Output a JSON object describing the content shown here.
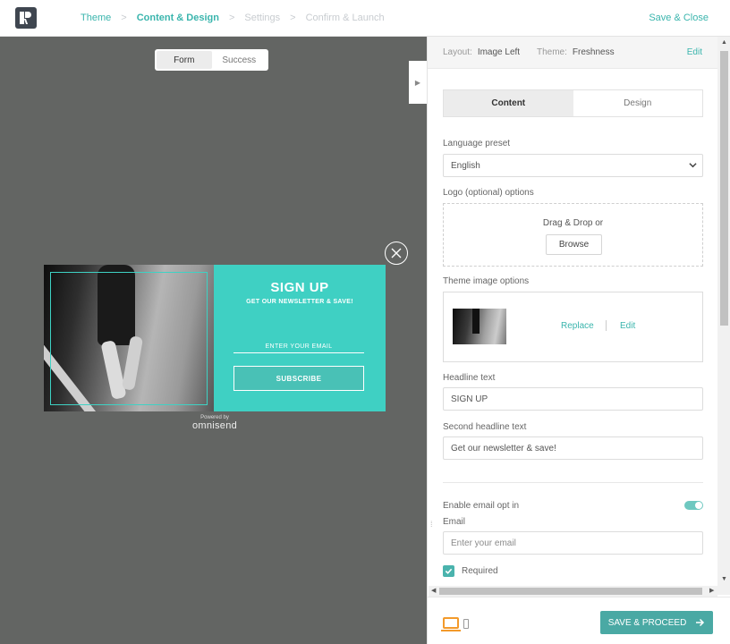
{
  "topbar": {
    "steps": [
      "Theme",
      "Content & Design",
      "Settings",
      "Confirm & Launch"
    ],
    "separator": ">",
    "save_close": "Save & Close",
    "logo_icon": "omnisend-logo-icon"
  },
  "preview": {
    "toggle": {
      "form": "Form",
      "success": "Success",
      "selected": "Form"
    },
    "popup": {
      "title": "SIGN UP",
      "subtitle": "GET OUR NEWSLETTER & SAVE!",
      "email_placeholder": "ENTER YOUR EMAIL",
      "button": "SUBSCRIBE",
      "accent_color": "#3fd0c3"
    },
    "powered_by": "Powered by",
    "brand": "omnisend"
  },
  "panel": {
    "header": {
      "layout_label": "Layout:",
      "layout_value": "Image Left",
      "theme_label": "Theme:",
      "theme_value": "Freshness",
      "edit": "Edit"
    },
    "tabs": {
      "content": "Content",
      "design": "Design",
      "active": "Content"
    },
    "language": {
      "label": "Language preset",
      "value": "English"
    },
    "logo": {
      "label": "Logo (optional) options",
      "drop_text": "Drag & Drop or",
      "browse": "Browse"
    },
    "theme_image": {
      "label": "Theme image options",
      "replace": "Replace",
      "edit": "Edit"
    },
    "headline": {
      "label": "Headline text",
      "value": "SIGN UP"
    },
    "second_headline": {
      "label": "Second headline text",
      "value": "Get our newsletter & save!"
    },
    "email_opt_in": {
      "label": "Enable email opt in",
      "enabled": true
    },
    "email": {
      "label": "Email",
      "placeholder": "Enter your email",
      "required_label": "Required",
      "required": true
    },
    "footer": {
      "proceed": "SAVE & PROCEED",
      "proceed_icon": "arrow-right-icon"
    },
    "accent_color": "#3ab5ad",
    "device_active_color": "#f39a2b"
  }
}
